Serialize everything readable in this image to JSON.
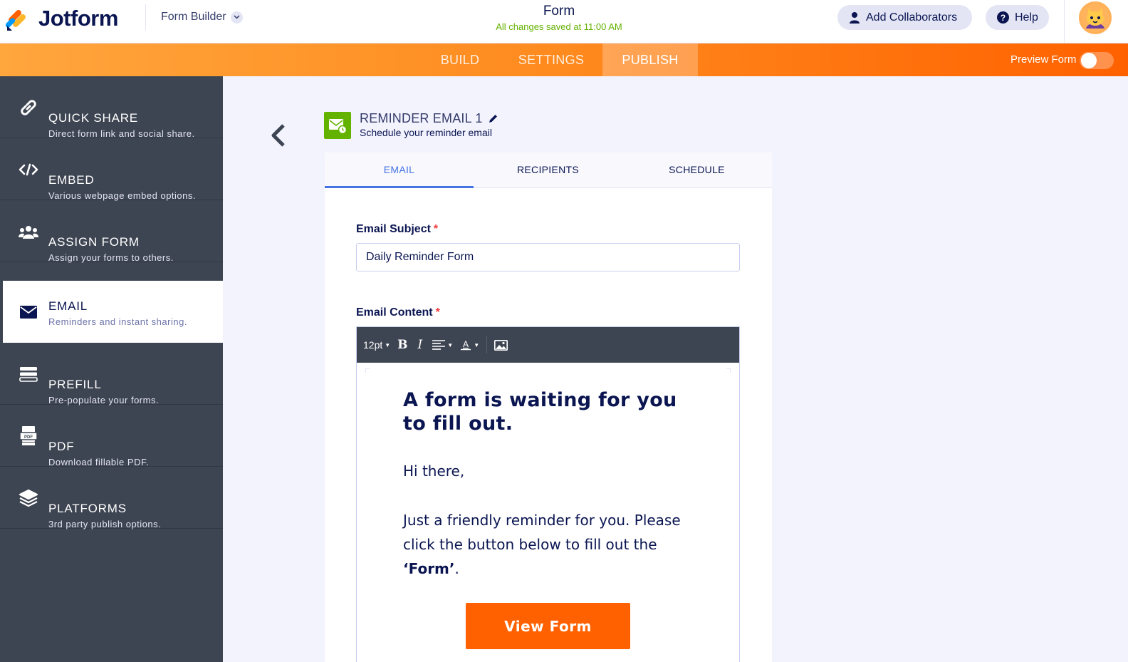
{
  "header": {
    "brand": "Jotform",
    "builder_label": "Form Builder",
    "form_title": "Form",
    "saved_status": "All changes saved at 11:00 AM",
    "collab_label": "Add Collaborators",
    "help_label": "Help"
  },
  "nav": {
    "tabs": [
      "BUILD",
      "SETTINGS",
      "PUBLISH"
    ],
    "active_tab": "PUBLISH",
    "preview_label": "Preview Form",
    "preview_enabled": false
  },
  "sidebar": {
    "items": [
      {
        "title": "QUICK SHARE",
        "subtitle": "Direct form link and social share.",
        "icon": "link-icon"
      },
      {
        "title": "EMBED",
        "subtitle": "Various webpage embed options.",
        "icon": "code-icon"
      },
      {
        "title": "ASSIGN FORM",
        "subtitle": "Assign your forms to others.",
        "icon": "users-icon"
      },
      {
        "title": "EMAIL",
        "subtitle": "Reminders and instant sharing.",
        "icon": "envelope-icon"
      },
      {
        "title": "PREFILL",
        "subtitle": "Pre-populate your forms.",
        "icon": "prefill-icon"
      },
      {
        "title": "PDF",
        "subtitle": "Download fillable PDF.",
        "icon": "pdf-icon"
      },
      {
        "title": "PLATFORMS",
        "subtitle": "3rd party publish options.",
        "icon": "layers-icon"
      }
    ],
    "active_item": "EMAIL"
  },
  "reminder": {
    "title": "REMINDER EMAIL 1",
    "subtitle": "Schedule your reminder email",
    "tabs": [
      "EMAIL",
      "RECIPIENTS",
      "SCHEDULE"
    ],
    "active_tab": "EMAIL"
  },
  "email_form": {
    "subject_label": "Email Subject",
    "subject_value": "Daily Reminder Form",
    "content_label": "Email Content",
    "required_mark": "*",
    "toolbar": {
      "font_size": "12pt",
      "bold": "B",
      "italic": "I"
    },
    "body": {
      "heading": "A form is waiting for you to fill out.",
      "greeting": "Hi there,",
      "paragraph_start": "Just a friendly reminder for you. Please click the button below to fill out the ",
      "form_name": "‘Form’",
      "paragraph_end": ".",
      "button_label": "View Form"
    }
  },
  "colors": {
    "accent_orange": "#ff6100",
    "sidebar_bg": "#3e4552",
    "saved_green": "#64b200",
    "tab_active_blue": "#4573e3"
  }
}
